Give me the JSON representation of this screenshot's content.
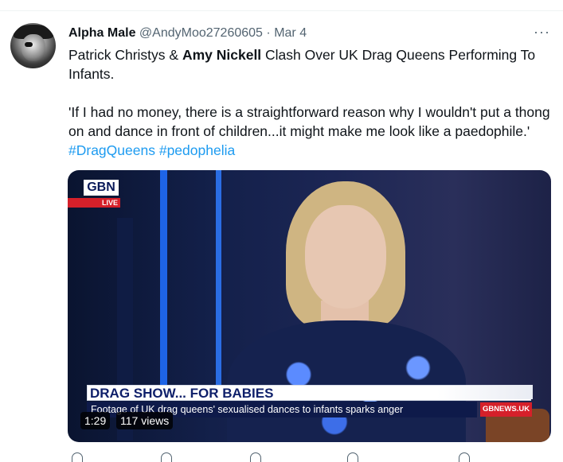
{
  "tweet": {
    "author_name": "Alpha Male",
    "handle": "@AndyMoo27260605",
    "separator": "·",
    "date": "Mar 4",
    "more_label": "···",
    "text_part1": "Patrick Christys & ",
    "text_bold": "Amy Nickell",
    "text_part2": " Clash Over UK Drag Queens Performing To Infants.",
    "quote": "'If I had no money, there is a straightforward reason why I wouldn't put a thong on and dance in front of children...it might make me look like a paedophile.' ",
    "hashtag1": "#DragQueens",
    "hashtag2": "#pedophelia"
  },
  "video": {
    "logo": "GBN",
    "live_badge": "LIVE",
    "headline": "DRAG SHOW... FOR BABIES",
    "subline": "Footage of UK drag queens' sexualised dances to infants sparks anger",
    "site_tag": "GBNEWS.UK",
    "duration": "1:29",
    "views": "117 views"
  },
  "icons": [
    "more-icon",
    "reply-icon",
    "retweet-icon",
    "like-icon",
    "views-icon",
    "share-icon"
  ]
}
